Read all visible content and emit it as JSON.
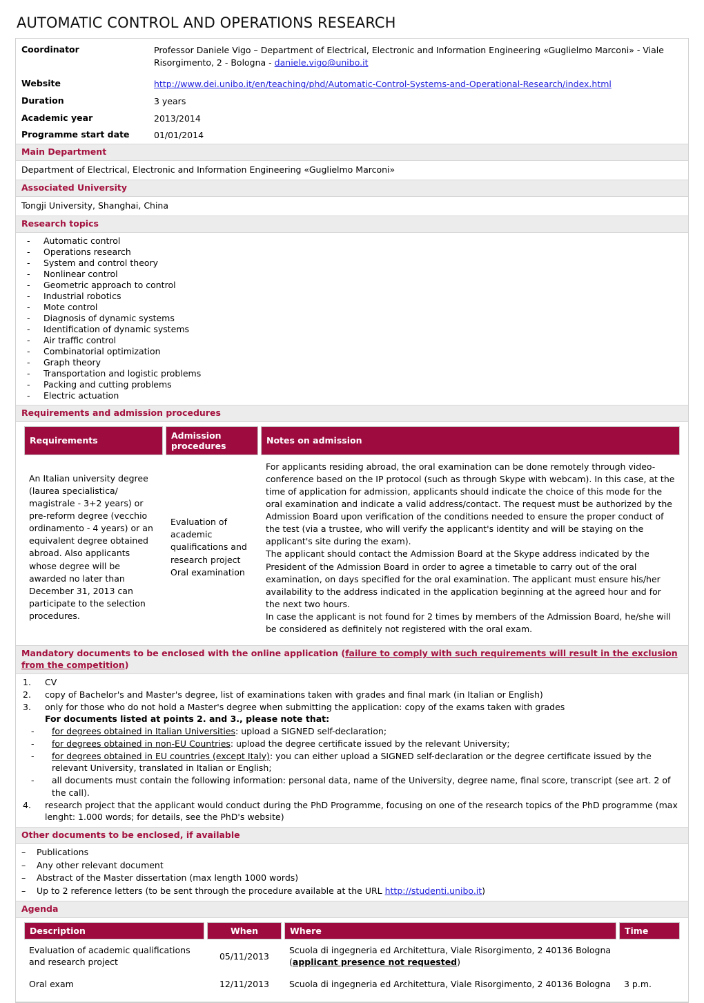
{
  "document": {
    "title": "AUTOMATIC CONTROL AND OPERATIONS RESEARCH"
  },
  "colors": {
    "accent": "#A4123F",
    "table_header_bg": "#9E0B3F",
    "section_bar_bg": "#ECECEC",
    "link": "#2222DD"
  },
  "info": {
    "coordinator": {
      "label": "Coordinator",
      "text_before_link": "Professor Daniele Vigo – Department of Electrical, Electronic and Information Engineering «Guglielmo Marconi» - Viale Risorgimento, 2 - Bologna - ",
      "email": "daniele.vigo@unibo.it"
    },
    "website": {
      "label": "Website",
      "url": "http://www.dei.unibo.it/en/teaching/phd/Automatic-Control-Systems-and-Operational-Research/index.html"
    },
    "duration": {
      "label": "Duration",
      "value": "3 years"
    },
    "academic_year": {
      "label": "Academic year",
      "value": "2013/2014"
    },
    "programme_start_date": {
      "label": "Programme start date",
      "value": "01/01/2014"
    }
  },
  "main_department": {
    "heading": "Main Department",
    "value": "Department of Electrical, Electronic and Information Engineering «Guglielmo Marconi»"
  },
  "associated_university": {
    "heading": "Associated University",
    "value": "Tongji University, Shanghai, China"
  },
  "research_topics": {
    "heading": "Research topics",
    "marker": "-",
    "items": [
      "Automatic control",
      "Operations research",
      "System and control theory",
      "Nonlinear control",
      "Geometric approach to control",
      "Industrial robotics",
      "Mote control",
      "Diagnosis of dynamic systems",
      "Identification of dynamic systems",
      "Air traffic control",
      "Combinatorial optimization",
      "Graph theory",
      "Transportation and logistic problems",
      "Packing and cutting problems",
      "Electric actuation"
    ]
  },
  "requirements_section": {
    "heading": "Requirements and admission procedures",
    "columns": {
      "requirements": "Requirements",
      "admission_procedures": "Admission procedures",
      "notes": "Notes on admission"
    },
    "requirements_text": "An Italian university degree (laurea specialistica/ magistrale - 3+2 years) or pre-reform degree (vecchio ordinamento - 4 years) or an equivalent degree obtained abroad. Also applicants whose degree will be awarded no later than December 31, 2013 can participate to the selection procedures.",
    "admission_procedures_text": "Evaluation of academic qualifications and research project Oral examination",
    "notes_paragraphs": [
      "For applicants residing abroad, the oral examination can be done remotely through video-conference based on the IP protocol (such as through Skype with webcam). In this case, at the time of application for admission, applicants should indicate the choice of this mode for the oral examination and indicate a valid address/contact. The request must be authorized by the Admission Board upon verification of the conditions needed to ensure the proper conduct of the test (via a trustee, who will verify the applicant's identity and will be staying on the applicant's site during the exam).",
      "The applicant should contact the Admission Board at the Skype address indicated by the President of the Admission Board in order to agree a timetable to carry out of the oral examination, on days specified for the oral examination. The applicant must ensure his/her availability to the address indicated in the application beginning at the agreed hour and for the next two hours.",
      "In case the applicant is not found for 2 times by members of the Admission Board, he/she will be considered as definitely not registered with the oral exam."
    ]
  },
  "mandatory_documents": {
    "heading_plain": "Mandatory documents to be enclosed with the online application (",
    "heading_underlined": "failure to comply with such requirements will result in the exclusion from the competition",
    "heading_tail": ")",
    "items": [
      {
        "marker": "1.",
        "text": "CV"
      },
      {
        "marker": "2.",
        "text": "copy of Bachelor's and Master's degree, list of examinations taken with grades and final mark (in Italian or English)"
      },
      {
        "marker": "3.",
        "text": "only for those who do not hold a Master's degree when submitting the application: copy of the exams taken with grades"
      }
    ],
    "note_bold": "For documents listed at points 2. and 3., please note that:",
    "sub_marker": "-",
    "sub_items": [
      {
        "underlined": "for degrees obtained in Italian Universities",
        "rest": ": upload a SIGNED self-declaration;"
      },
      {
        "underlined": "for degrees obtained in non-EU Countries",
        "rest": ": upload the degree certificate issued by the relevant University;"
      },
      {
        "underlined": "for degrees obtained in EU countries (except Italy)",
        "rest": ": you can either upload a SIGNED self-declaration or the degree certificate issued by the relevant University, translated in Italian or English;"
      },
      {
        "underlined": "",
        "rest": "all documents must contain the following information: personal data, name of the University, degree name, final score, transcript (see art. 2 of the call)."
      }
    ],
    "item4": {
      "marker": "4.",
      "text": "research project that the applicant would conduct during the PhD Programme, focusing on one of the research topics of the PhD programme (max lenght: 1.000 words; for details, see the PhD's website)"
    }
  },
  "other_documents": {
    "heading": "Other documents to be enclosed, if available",
    "marker": "–",
    "items": [
      {
        "text": "Publications"
      },
      {
        "text": "Any other relevant document"
      },
      {
        "text": "Abstract of the Master dissertation (max length 1000 words)"
      },
      {
        "text": "Up to 2 reference letters (to be sent through the procedure available at the URL ",
        "link": "http://studenti.unibo.it",
        "tail": ")"
      }
    ]
  },
  "agenda": {
    "heading": "Agenda",
    "columns": {
      "description": "Description",
      "when": "When",
      "where": "Where",
      "time": "Time"
    },
    "rows": [
      {
        "description": "Evaluation of academic qualifications and research project",
        "when": "05/11/2013",
        "where_plain": "Scuola di ingegneria ed Architettura, Viale Risorgimento, 2 40136 Bologna (",
        "where_bold": "applicant presence not requested",
        "where_tail": ")",
        "time": ""
      },
      {
        "description": "Oral exam",
        "when": "12/11/2013",
        "where_plain": "Scuola di ingegneria ed Architettura, Viale Risorgimento, 2 40136 Bologna",
        "where_bold": "",
        "where_tail": "",
        "time": "3 p.m."
      }
    ]
  }
}
